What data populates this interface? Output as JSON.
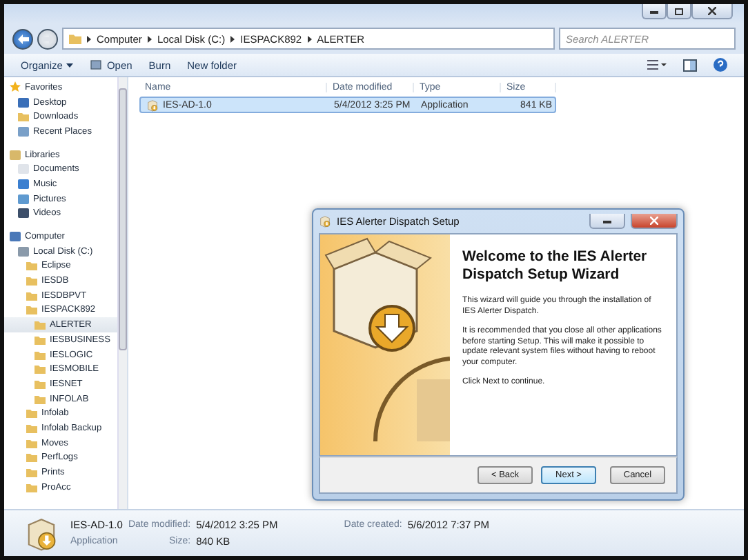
{
  "address": {
    "crumbs": [
      "Computer",
      "Local Disk (C:)",
      "IESPACK892",
      "ALERTER"
    ],
    "search_placeholder": "Search ALERTER"
  },
  "toolbar": {
    "items": [
      {
        "label": "Organize",
        "kind": "menu"
      },
      {
        "label": "Open",
        "kind": "icon"
      },
      {
        "label": "Burn",
        "kind": "plain"
      },
      {
        "label": "New folder",
        "kind": "plain"
      }
    ]
  },
  "nav": [
    {
      "label": "Favorites",
      "kind": "star",
      "selected": false,
      "children": [
        {
          "label": "Desktop",
          "kind": "desktop",
          "selected": false
        },
        {
          "label": "Downloads",
          "kind": "folder",
          "selected": false
        },
        {
          "label": "Recent Places",
          "kind": "recent",
          "selected": false
        }
      ]
    },
    {
      "label": "Libraries",
      "kind": "library",
      "selected": false,
      "children": [
        {
          "label": "Documents",
          "kind": "document",
          "selected": false
        },
        {
          "label": "Music",
          "kind": "music",
          "selected": false
        },
        {
          "label": "Pictures",
          "kind": "picture",
          "selected": false
        },
        {
          "label": "Videos",
          "kind": "video",
          "selected": false
        }
      ]
    },
    {
      "label": "Computer",
      "kind": "computer",
      "selected": false,
      "children": [
        {
          "label": "Local Disk (C:)",
          "kind": "disk",
          "selected": false,
          "children": [
            {
              "label": "Eclipse",
              "kind": "folder",
              "selected": false
            },
            {
              "label": "IESDB",
              "kind": "folder",
              "selected": false
            },
            {
              "label": "IESDBPVT",
              "kind": "folder",
              "selected": false
            },
            {
              "label": "IESPACK892",
              "kind": "folder",
              "selected": false,
              "children": [
                {
                  "label": "ALERTER",
                  "kind": "folder",
                  "selected": true
                },
                {
                  "label": "IESBUSINESS",
                  "kind": "folder",
                  "selected": false
                },
                {
                  "label": "IESLOGIC",
                  "kind": "folder",
                  "selected": false
                },
                {
                  "label": "IESMOBILE",
                  "kind": "folder",
                  "selected": false
                },
                {
                  "label": "IESNET",
                  "kind": "folder",
                  "selected": false
                },
                {
                  "label": "INFOLAB",
                  "kind": "folder",
                  "selected": false
                }
              ]
            },
            {
              "label": "Infolab",
              "kind": "folder",
              "selected": false
            },
            {
              "label": "Infolab Backup",
              "kind": "folder",
              "selected": false
            },
            {
              "label": "Moves",
              "kind": "folder",
              "selected": false
            },
            {
              "label": "PerfLogs",
              "kind": "folder",
              "selected": false
            },
            {
              "label": "Prints",
              "kind": "folder",
              "selected": false
            },
            {
              "label": "ProAcc",
              "kind": "folder",
              "selected": false
            }
          ]
        }
      ]
    }
  ],
  "table": {
    "columns": [
      "Name",
      "Date modified",
      "Type",
      "Size"
    ],
    "rows": [
      {
        "cells": [
          "IES-AD-1.0",
          "5/4/2012 3:25 PM",
          "Application",
          "841 KB"
        ],
        "selected": true
      }
    ]
  },
  "dialog": {
    "title": "IES Alerter Dispatch Setup",
    "heading": "Welcome to the IES Alerter Dispatch Setup Wizard",
    "paragraphs": [
      "This wizard will guide you through the installation of IES Alerter Dispatch.",
      "It is recommended that you close all other applications before starting Setup. This will make it possible to update relevant system files without having to reboot your computer.",
      "Click Next to continue."
    ],
    "buttons": [
      {
        "label": "< Back",
        "selected": false
      },
      {
        "label": "Next >",
        "selected": true
      },
      {
        "label": "Cancel",
        "selected": false
      }
    ]
  },
  "details": {
    "name": "IES-AD-1.0",
    "type": "Application",
    "fields": [
      {
        "label": "Date modified:",
        "value": "5/4/2012 3:25 PM"
      },
      {
        "label": "Date created:",
        "value": "5/6/2012 7:37 PM"
      },
      {
        "label": "Size:",
        "value": "840 KB"
      }
    ]
  }
}
